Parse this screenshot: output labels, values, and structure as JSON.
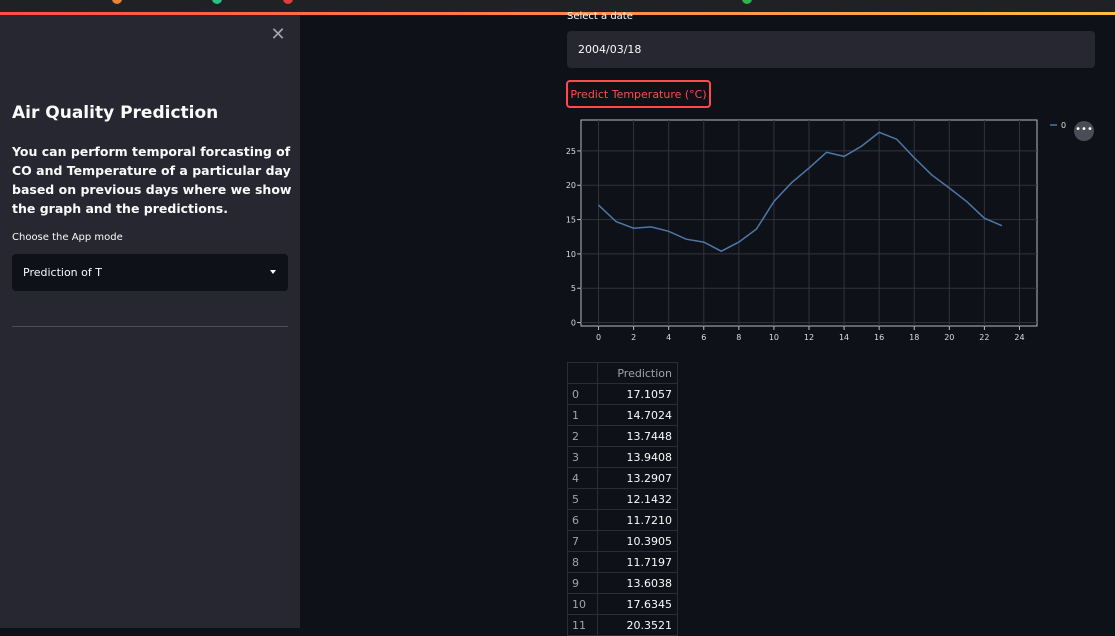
{
  "sidebar": {
    "title": "Air Quality Prediction",
    "description": "You can perform temporal forcasting of CO and Temperature of a particular day based on previous days where we show the graph and the predictions.",
    "mode_label": "Choose the App mode",
    "mode_value": "Prediction of T",
    "close_icon": "close-icon"
  },
  "main": {
    "date_label": "Select a date",
    "date_value": "2004/03/18",
    "predict_button": "Predict Temperature (°C)",
    "table_header": "Prediction",
    "more_icon": "more-icon"
  },
  "colors": {
    "accent": "#ff4b4b",
    "line": "#4c78a8",
    "sidebar_bg": "#262730",
    "page_bg": "#0e1117"
  },
  "chart_data": {
    "type": "line",
    "x": [
      0,
      1,
      2,
      3,
      4,
      5,
      6,
      7,
      8,
      9,
      10,
      11,
      12,
      13,
      14,
      15,
      16,
      17,
      18,
      19,
      20,
      21,
      22,
      23
    ],
    "series": [
      {
        "name": "0",
        "values": [
          17.1057,
          14.7024,
          13.7448,
          13.9408,
          13.2907,
          12.1432,
          11.721,
          10.3905,
          11.7197,
          13.6038,
          17.6345,
          20.3521,
          22.5,
          24.8,
          24.2,
          25.7,
          27.7,
          26.7,
          24.0,
          21.5,
          19.6,
          17.6,
          15.2,
          14.1
        ]
      }
    ],
    "xticks": [
      "0",
      "2",
      "4",
      "6",
      "8",
      "10",
      "12",
      "14",
      "16",
      "18",
      "20",
      "22",
      "24"
    ],
    "yticks": [
      "0",
      "5",
      "10",
      "15",
      "20",
      "25"
    ],
    "xlim": [
      -1,
      25
    ],
    "ylim": [
      -0.5,
      29.5
    ],
    "grid": true,
    "legend": "top-right"
  },
  "table": [
    {
      "index": "0",
      "value": "17.1057"
    },
    {
      "index": "1",
      "value": "14.7024"
    },
    {
      "index": "2",
      "value": "13.7448"
    },
    {
      "index": "3",
      "value": "13.9408"
    },
    {
      "index": "4",
      "value": "13.2907"
    },
    {
      "index": "5",
      "value": "12.1432"
    },
    {
      "index": "6",
      "value": "11.7210"
    },
    {
      "index": "7",
      "value": "10.3905"
    },
    {
      "index": "8",
      "value": "11.7197"
    },
    {
      "index": "9",
      "value": "13.6038"
    },
    {
      "index": "10",
      "value": "17.6345"
    },
    {
      "index": "11",
      "value": "20.3521"
    }
  ]
}
